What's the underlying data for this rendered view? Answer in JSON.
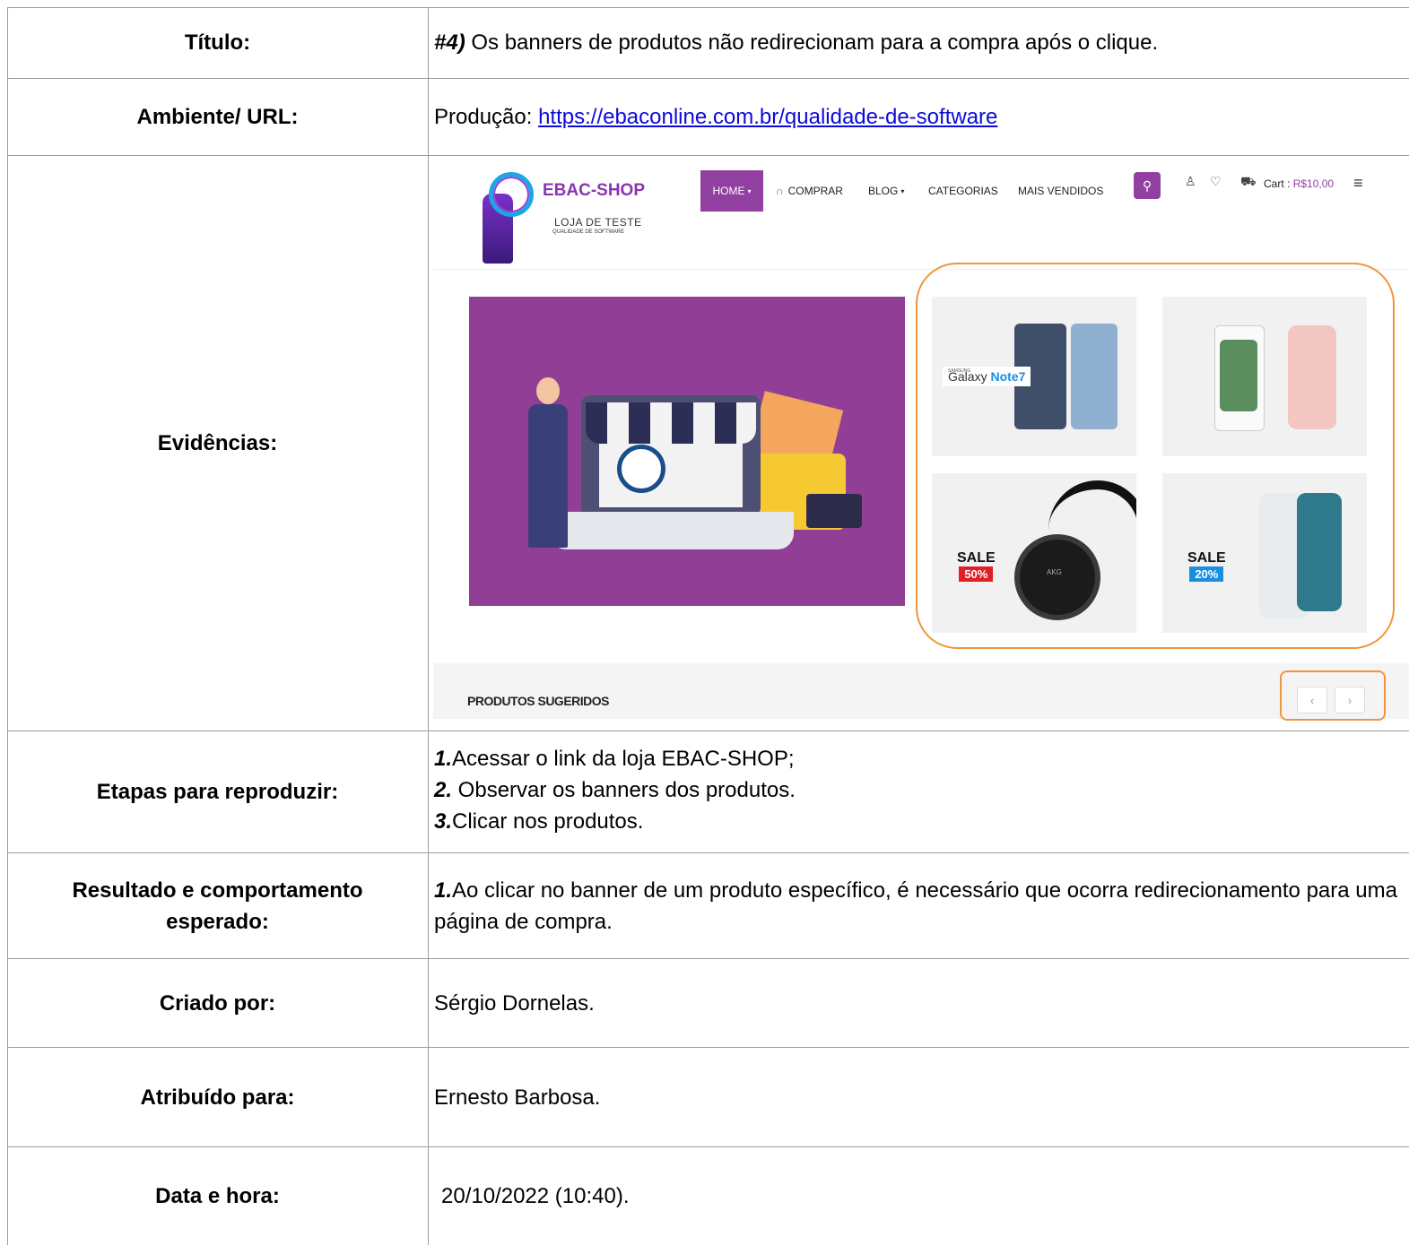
{
  "rows": {
    "title": {
      "label": "Título:",
      "prefix": "#4)",
      "text": " Os banners de produtos não redirecionam para a compra após o clique."
    },
    "environment": {
      "label": "Ambiente/ URL:",
      "prefix": "Produção: ",
      "url": "https://ebaconline.com.br/qualidade-de-software"
    },
    "evidence": {
      "label": "Evidências:"
    },
    "steps": {
      "label": "Etapas para reproduzir:",
      "items": [
        {
          "num": "1.",
          "text": "Acessar o link da loja EBAC-SHOP;"
        },
        {
          "num": "2.",
          "text": " Observar os banners dos produtos."
        },
        {
          "num": "3.",
          "text": "Clicar nos produtos."
        }
      ]
    },
    "expected": {
      "label": "Resultado e comportamento esperado:",
      "num": "1.",
      "text": "Ao clicar no banner de um produto específico, é necessário que ocorra redirecionamento para uma página de compra."
    },
    "created_by": {
      "label": "Criado por:",
      "value": "Sérgio Dornelas."
    },
    "assigned_to": {
      "label": "Atribuído para:",
      "value": "Ernesto Barbosa."
    },
    "datetime": {
      "label": "Data e hora:",
      "value": "20/10/2022 (10:40)."
    }
  },
  "evidence_shot": {
    "brand": "EBAC-SHOP",
    "brand_sub": "LOJA DE TESTE",
    "brand_sub2": "QUALIDADE DE SOFTWARE",
    "nav": {
      "home": "HOME",
      "comprar": "COMPRAR",
      "blog": "BLOG",
      "categorias": "CATEGORIAS",
      "mais_vendidos": "MAIS VENDIDOS"
    },
    "cart_label": "Cart :",
    "cart_value": "R$10,00",
    "products": {
      "galaxy_brand": "SAMSUNG",
      "galaxy_name": "Galaxy",
      "galaxy_model": "Note7",
      "headphone_brand": "AKG",
      "sale_word": "SALE",
      "sale_1": "50%",
      "sale_2": "20%"
    },
    "suggested_title": "PRODUTOS SUGERIDOS",
    "prev_arrow": "‹",
    "next_arrow": "›",
    "colors": {
      "brand_purple": "#913fa0",
      "highlight_orange": "#f0953e",
      "sale_red": "#e01f26",
      "sale_blue": "#1a8fe0"
    }
  }
}
